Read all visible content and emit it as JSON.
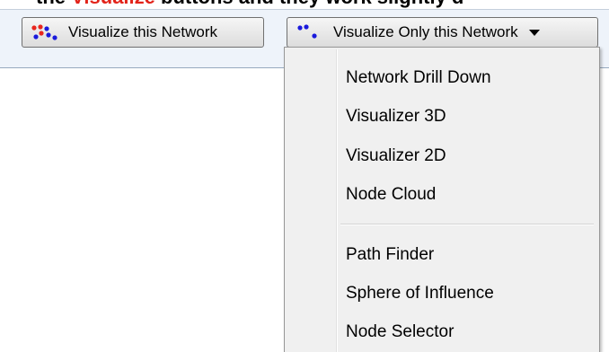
{
  "caption": {
    "before": "the ",
    "accent_word": "Visualize",
    "after": " buttons and they work slightly d",
    "accent_color": "#e2231a"
  },
  "toolbar": {
    "visualize_button": {
      "label": "Visualize this Network",
      "icon": "network-dots-red-blue-icon"
    },
    "visualize_only_button": {
      "label": "Visualize Only this Network",
      "icon": "network-dots-blue-icon",
      "has_dropdown": true
    }
  },
  "menu": {
    "items": [
      {
        "label": "Network Drill Down"
      },
      {
        "label": "Visualizer 3D"
      },
      {
        "label": "Visualizer 2D"
      },
      {
        "label": "Node Cloud"
      },
      {
        "label": "Path Finder"
      },
      {
        "label": "Sphere of Influence"
      },
      {
        "label": "Node Selector"
      }
    ]
  },
  "colors": {
    "dot_red": "#e8261e",
    "dot_blue": "#1a1adc",
    "toolbar_bg": "#eef3fa",
    "menu_bg": "#f0f0f0"
  }
}
